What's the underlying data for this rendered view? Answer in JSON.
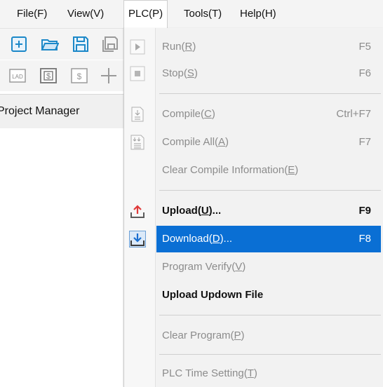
{
  "menubar": {
    "items": [
      "File(F)",
      "View(V)",
      "PLC(P)",
      "Tools(T)",
      "Help(H)"
    ],
    "open_index": 2
  },
  "toolbar": {
    "row1": [
      "new-file-icon",
      "open-folder-icon",
      "save-icon",
      "save-all-icon"
    ],
    "row2": [
      "ladder-icon",
      "stl-icon",
      "stl-alt-icon",
      "crosshair-icon"
    ]
  },
  "panel": {
    "title": "Project Manager"
  },
  "plc_menu": {
    "items": [
      {
        "pre": "Run(",
        "key": "R",
        "post": ")",
        "shortcut": "F5",
        "state": "disabled",
        "icon": "run-icon"
      },
      {
        "pre": "Stop(",
        "key": "S",
        "post": ")",
        "shortcut": "F6",
        "state": "disabled",
        "icon": "stop-icon"
      },
      {
        "pre": "Compile(",
        "key": "C",
        "post": ")",
        "shortcut": "Ctrl+F7",
        "state": "disabled",
        "icon": "compile-icon"
      },
      {
        "pre": "Compile All(",
        "key": "A",
        "post": ")",
        "shortcut": "F7",
        "state": "disabled",
        "icon": "compile-all-icon"
      },
      {
        "pre": "Clear Compile Information(",
        "key": "E",
        "post": ")",
        "shortcut": "",
        "state": "disabled",
        "icon": ""
      },
      {
        "pre": "Upload(",
        "key": "U",
        "post": ")...",
        "shortcut": "F9",
        "state": "enabled",
        "icon": "upload-icon"
      },
      {
        "pre": "Download(",
        "key": "D",
        "post": ")...",
        "shortcut": "F8",
        "state": "highlighted",
        "icon": "download-icon"
      },
      {
        "pre": "Program Verify(",
        "key": "V",
        "post": ")",
        "shortcut": "",
        "state": "disabled",
        "icon": ""
      },
      {
        "pre": "Upload Updown File",
        "key": "",
        "post": "",
        "shortcut": "",
        "state": "enabled",
        "icon": ""
      },
      {
        "pre": "Clear Program(",
        "key": "P",
        "post": ")",
        "shortcut": "",
        "state": "disabled",
        "icon": ""
      },
      {
        "pre": "PLC Time Setting(",
        "key": "T",
        "post": ")",
        "shortcut": "",
        "state": "disabled",
        "icon": ""
      }
    ]
  },
  "colors": {
    "highlight": "#0a6fd4",
    "disabled_text": "#8c8c8c",
    "upload_arrow": "#e03a3a",
    "download_arrow": "#1a6fd0"
  }
}
